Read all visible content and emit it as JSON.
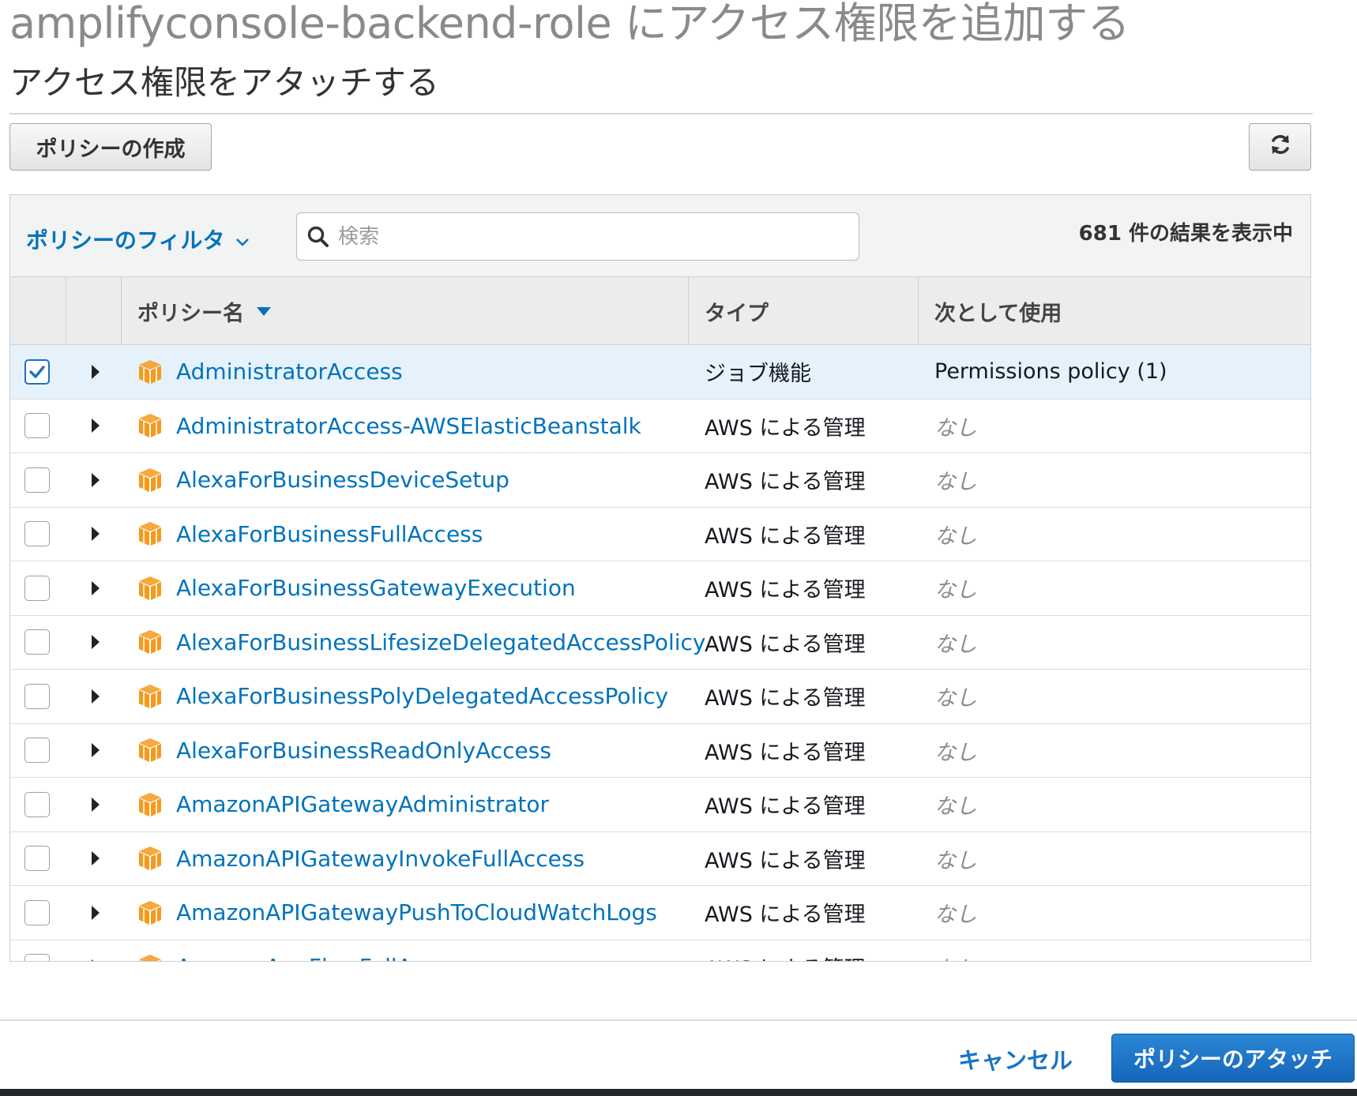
{
  "title": "amplifyconsole-backend-role にアクセス権限を追加する",
  "subtitle": "アクセス権限をアタッチする",
  "toolbar": {
    "create_policy_label": "ポリシーの作成",
    "refresh_icon": "refresh-icon"
  },
  "filter": {
    "label": "ポリシーのフィルタ",
    "search_placeholder": "検索",
    "results_text": "681 件の結果を表示中"
  },
  "table": {
    "headers": {
      "name": "ポリシー名",
      "type": "タイプ",
      "used_as": "次として使用"
    },
    "rows": [
      {
        "name": "AdministratorAccess",
        "type": "ジョブ機能",
        "used_as": "Permissions policy (1)",
        "checked": true
      },
      {
        "name": "AdministratorAccess-AWSElasticBeanstalk",
        "type": "AWS による管理",
        "used_as": "なし",
        "checked": false
      },
      {
        "name": "AlexaForBusinessDeviceSetup",
        "type": "AWS による管理",
        "used_as": "なし",
        "checked": false
      },
      {
        "name": "AlexaForBusinessFullAccess",
        "type": "AWS による管理",
        "used_as": "なし",
        "checked": false
      },
      {
        "name": "AlexaForBusinessGatewayExecution",
        "type": "AWS による管理",
        "used_as": "なし",
        "checked": false
      },
      {
        "name": "AlexaForBusinessLifesizeDelegatedAccessPolicy",
        "type": "AWS による管理",
        "used_as": "なし",
        "checked": false
      },
      {
        "name": "AlexaForBusinessPolyDelegatedAccessPolicy",
        "type": "AWS による管理",
        "used_as": "なし",
        "checked": false
      },
      {
        "name": "AlexaForBusinessReadOnlyAccess",
        "type": "AWS による管理",
        "used_as": "なし",
        "checked": false
      },
      {
        "name": "AmazonAPIGatewayAdministrator",
        "type": "AWS による管理",
        "used_as": "なし",
        "checked": false
      },
      {
        "name": "AmazonAPIGatewayInvokeFullAccess",
        "type": "AWS による管理",
        "used_as": "なし",
        "checked": false
      },
      {
        "name": "AmazonAPIGatewayPushToCloudWatchLogs",
        "type": "AWS による管理",
        "used_as": "なし",
        "checked": false
      },
      {
        "name": "AmazonAppFlowFullAccess",
        "type": "AWS による管理",
        "used_as": "なし",
        "checked": false
      }
    ]
  },
  "footer": {
    "cancel_label": "キャンセル",
    "attach_label": "ポリシーのアタッチ"
  },
  "colors": {
    "link": "#0073bb",
    "primary_button": "#1a6fc4",
    "selected_row": "#e6f2fb",
    "policy_icon": "#f59a1b"
  }
}
